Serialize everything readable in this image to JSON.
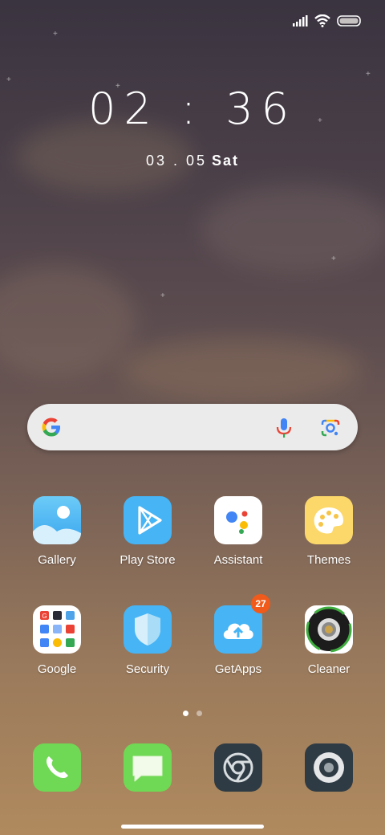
{
  "status_bar": {
    "signal_icon": "signal-bars-icon",
    "wifi_icon": "wifi-icon",
    "battery_icon": "battery-icon"
  },
  "lock": {
    "time": "02 : 36",
    "date": "03 . 05",
    "day": "Sat"
  },
  "search_bar": {
    "google_icon": "google-g-icon",
    "voice_icon": "microphone-icon",
    "lens_icon": "google-lens-icon"
  },
  "apps_row1": [
    {
      "label": "Gallery",
      "icon": "gallery-icon"
    },
    {
      "label": "Play Store",
      "icon": "play-store-icon"
    },
    {
      "label": "Assistant",
      "icon": "assistant-icon"
    },
    {
      "label": "Themes",
      "icon": "themes-palette-icon"
    }
  ],
  "apps_row2": [
    {
      "label": "Google",
      "icon": "google-folder-icon"
    },
    {
      "label": "Security",
      "icon": "security-shield-icon"
    },
    {
      "label": "GetApps",
      "icon": "getapps-cloud-icon",
      "badge": "27"
    },
    {
      "label": "Cleaner",
      "icon": "cleaner-icon"
    }
  ],
  "page_indicator": {
    "pages": 2,
    "current": 1
  },
  "dock": [
    {
      "icon": "phone-icon"
    },
    {
      "icon": "messages-icon"
    },
    {
      "icon": "chrome-browser-icon"
    },
    {
      "icon": "camera-icon"
    }
  ],
  "colors": {
    "accent_blue": "#46b4f5",
    "badge": "#f05a1a",
    "dock_green": "#6fd854"
  }
}
